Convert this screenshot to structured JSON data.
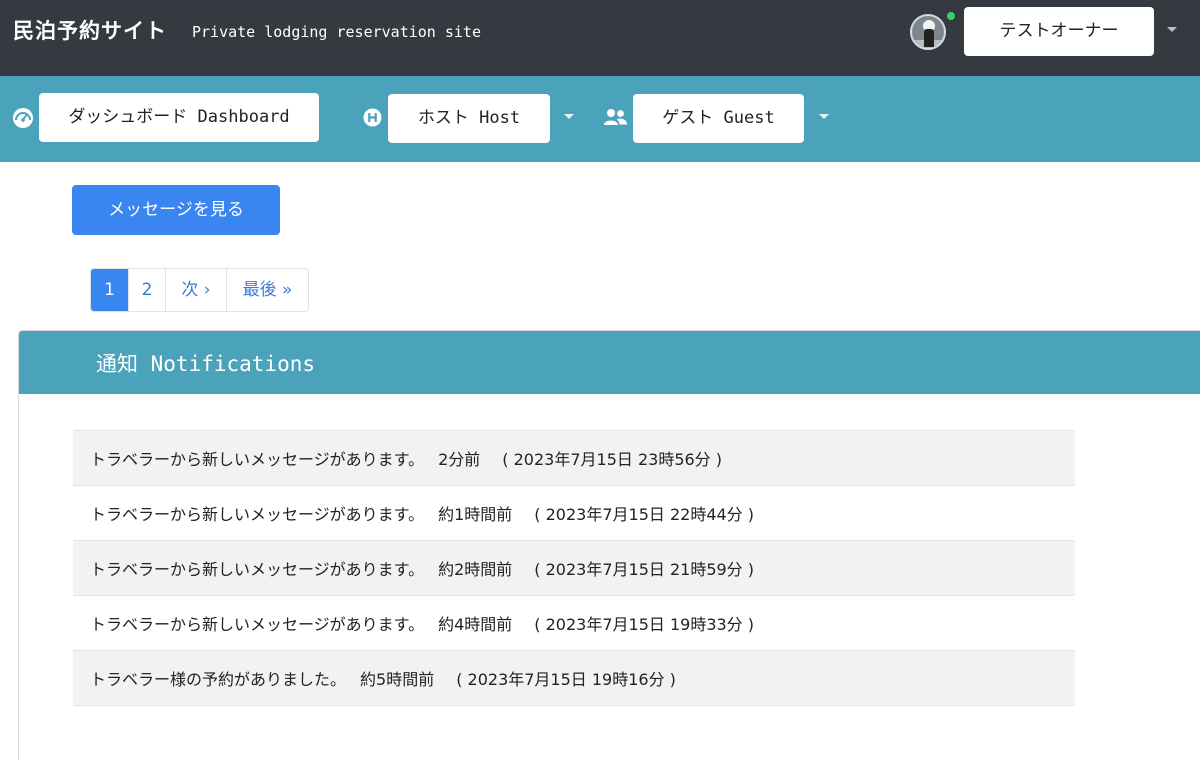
{
  "header": {
    "site_title": "民泊予約サイト",
    "site_subtitle": "Private lodging reservation site",
    "owner_label": "テストオーナー",
    "status_color": "#3ecf6b"
  },
  "nav": {
    "dashboard": {
      "label": "ダッシュボード Dashboard",
      "icon": "speedometer-icon"
    },
    "host": {
      "label": "ホスト Host",
      "icon": "host-h-icon"
    },
    "guest": {
      "label": "ゲスト Guest",
      "icon": "users-icon"
    }
  },
  "actions": {
    "view_messages": "メッセージを見る"
  },
  "pagination": {
    "pages": [
      "1",
      "2"
    ],
    "current": "1",
    "next": "次 ›",
    "last": "最後 »"
  },
  "notifications": {
    "title": "通知 Notifications",
    "items": [
      {
        "message": "トラベラーから新しいメッセージがあります。",
        "ago": "2分前",
        "when": "( 2023年7月15日 23時56分 )"
      },
      {
        "message": "トラベラーから新しいメッセージがあります。",
        "ago": "約1時間前",
        "when": "( 2023年7月15日 22時44分 )"
      },
      {
        "message": "トラベラーから新しいメッセージがあります。",
        "ago": "約2時間前",
        "when": "( 2023年7月15日 21時59分 )"
      },
      {
        "message": "トラベラーから新しいメッセージがあります。",
        "ago": "約4時間前",
        "when": "( 2023年7月15日 19時33分 )"
      },
      {
        "message": "トラベラー様の予約がありました。",
        "ago": "約5時間前",
        "when": "( 2023年7月15日 19時16分 )"
      }
    ]
  },
  "colors": {
    "header_bg": "#343a40",
    "nav_bg": "#4aa3ba",
    "primary": "#3a86f0"
  }
}
